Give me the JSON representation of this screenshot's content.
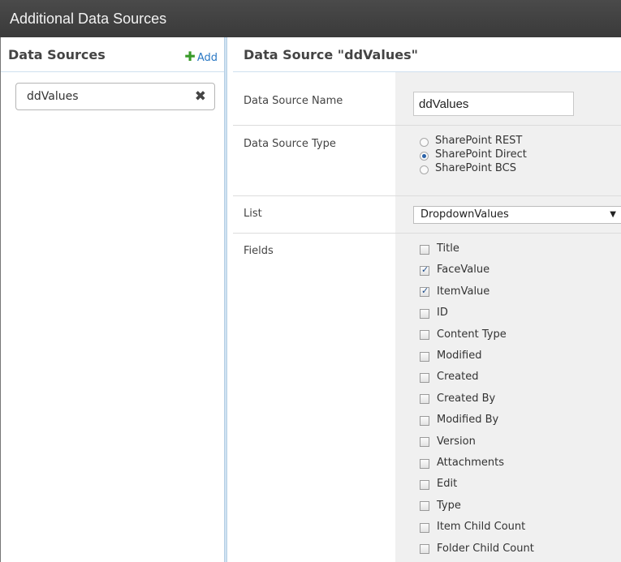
{
  "window": {
    "title": "Additional Data Sources"
  },
  "left_pane": {
    "title": "Data Sources",
    "add_label": "Add",
    "add_icon": "plus-icon",
    "items": [
      {
        "label": "ddValues",
        "remove_icon": "close-icon"
      }
    ]
  },
  "right_pane": {
    "title": "Data Source \"ddValues\"",
    "name_label": "Data Source Name",
    "name_value": "ddValues",
    "type_label": "Data Source Type",
    "type_options": [
      {
        "label": "SharePoint REST",
        "selected": false
      },
      {
        "label": "SharePoint Direct",
        "selected": true
      },
      {
        "label": "SharePoint BCS",
        "selected": false
      }
    ],
    "list_label": "List",
    "list_value": "DropdownValues",
    "fields_label": "Fields",
    "fields": [
      {
        "label": "Title",
        "checked": false
      },
      {
        "label": "FaceValue",
        "checked": true
      },
      {
        "label": "ItemValue",
        "checked": true
      },
      {
        "label": "ID",
        "checked": false
      },
      {
        "label": "Content Type",
        "checked": false
      },
      {
        "label": "Modified",
        "checked": false
      },
      {
        "label": "Created",
        "checked": false
      },
      {
        "label": "Created By",
        "checked": false
      },
      {
        "label": "Modified By",
        "checked": false
      },
      {
        "label": "Version",
        "checked": false
      },
      {
        "label": "Attachments",
        "checked": false
      },
      {
        "label": "Edit",
        "checked": false
      },
      {
        "label": "Type",
        "checked": false
      },
      {
        "label": "Item Child Count",
        "checked": false
      },
      {
        "label": "Folder Child Count",
        "checked": false
      }
    ]
  },
  "colors": {
    "accent": "#2a78c4",
    "add_plus": "#3a9b2a",
    "titlebar": "#404040"
  }
}
